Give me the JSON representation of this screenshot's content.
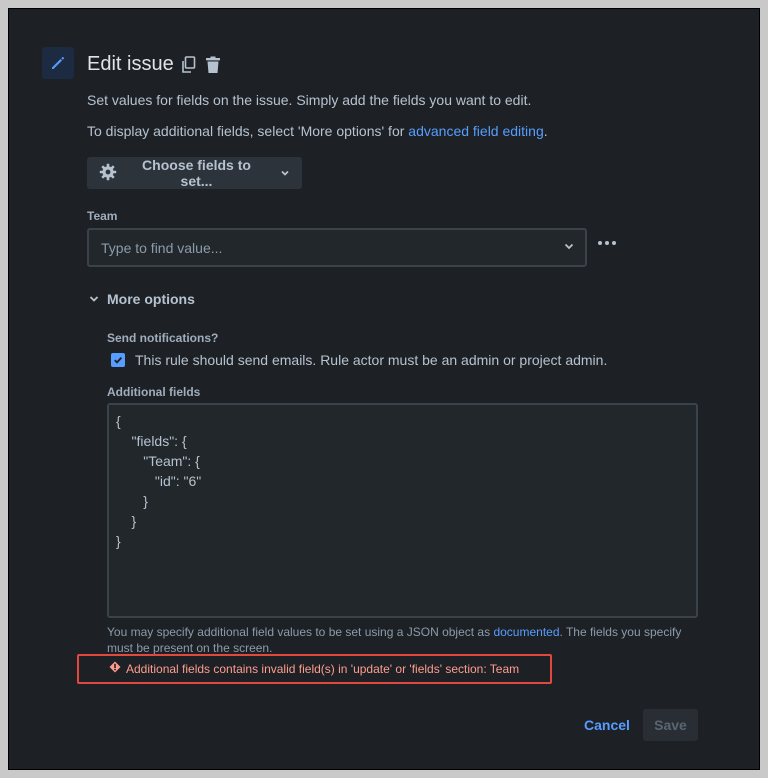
{
  "header": {
    "title": "Edit issue",
    "icon": "pencil-icon",
    "actions": [
      "copy-icon",
      "trash-icon"
    ]
  },
  "intro": {
    "line1": "Set values for fields on the issue. Simply add the fields you want to edit.",
    "line2_prefix": "To display additional fields, select 'More options' for ",
    "line2_link": "advanced field editing",
    "line2_suffix": "."
  },
  "choose_fields": {
    "label": "Choose fields to set...",
    "icon": "gear-icon"
  },
  "team": {
    "label": "Team",
    "placeholder": "Type to find value..."
  },
  "more_options": {
    "label": "More options",
    "send_notifications_label": "Send notifications?",
    "checkbox_text": "This rule should send emails. Rule actor must be an admin or project admin.",
    "checkbox_checked": true,
    "additional_fields_label": "Additional fields",
    "additional_fields_value": "{\n    \"fields\": {\n       \"Team\": {\n          \"id\": \"6\"\n       }\n    }\n}",
    "help_prefix": "You may specify additional field values to be set using a JSON object as ",
    "help_link": "documented",
    "help_suffix": ". The fields you specify must be present on the screen."
  },
  "error": {
    "text": "Additional fields contains invalid field(s) in 'update' or 'fields' section: Team",
    "icon": "error-icon"
  },
  "footer": {
    "cancel": "Cancel",
    "save": "Save"
  },
  "colors": {
    "background": "#1d2125",
    "accent": "#579dff",
    "error": "#e2483d"
  }
}
